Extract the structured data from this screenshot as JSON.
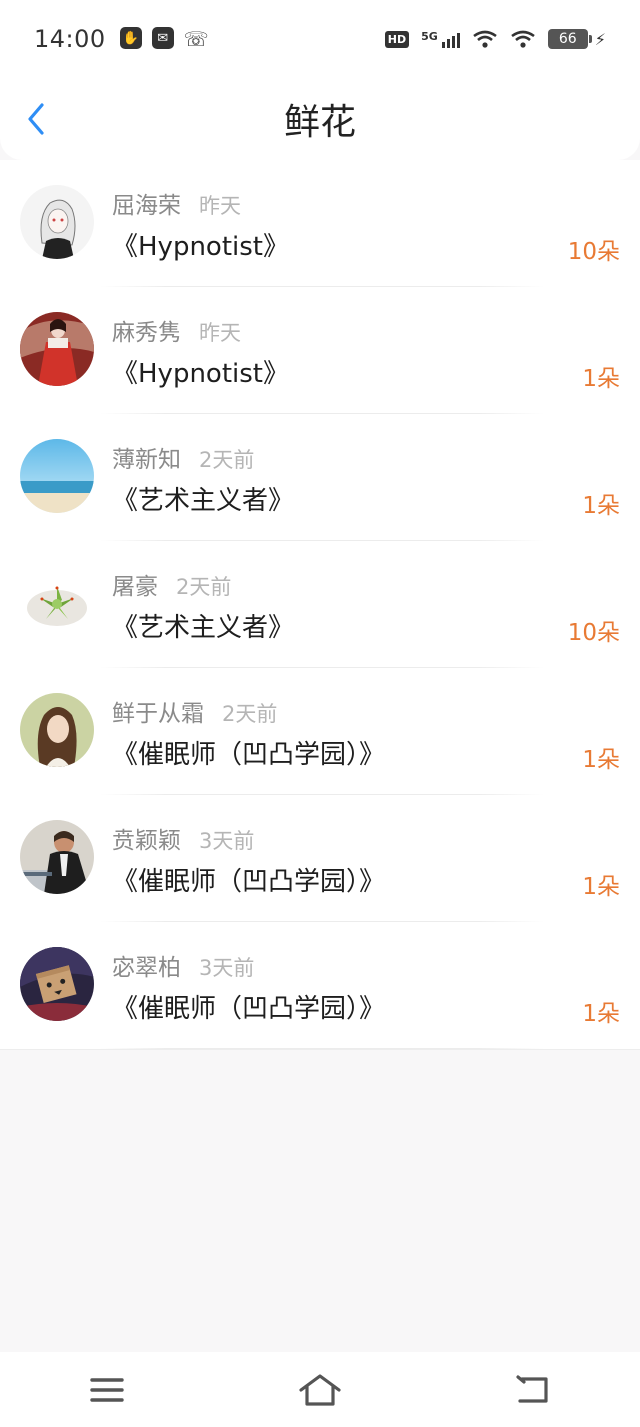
{
  "status_bar": {
    "time": "14:00",
    "left_icons": [
      "hand-icon",
      "mail-icon",
      "missed-call-icon"
    ],
    "hd_label": "HD",
    "network_label": "5G",
    "battery_level": "66"
  },
  "header": {
    "title": "鲜花",
    "back_icon": "chevron-left-icon"
  },
  "colors": {
    "accent_blue": "#2f8ef5",
    "flower_count_orange": "#e87a34",
    "name_gray": "#8a8a8a",
    "time_gray": "#b5b5b5"
  },
  "gifts": [
    {
      "name": "屈海荣",
      "time": "昨天",
      "book": "《Hypnotist》",
      "count": "10朵",
      "avatar": "sketch-girl-avatar"
    },
    {
      "name": "麻秀隽",
      "time": "昨天",
      "book": "《Hypnotist》",
      "count": "1朵",
      "avatar": "hanfu-girl-avatar"
    },
    {
      "name": "薄新知",
      "time": "2天前",
      "book": "《艺术主义者》",
      "count": "1朵",
      "avatar": "beach-sky-avatar"
    },
    {
      "name": "屠豪",
      "time": "2天前",
      "book": "《艺术主义者》",
      "count": "10朵",
      "avatar": "succulent-avatar"
    },
    {
      "name": "鲜于从霜",
      "time": "2天前",
      "book": "《催眠师（凹凸学园）》",
      "count": "1朵",
      "avatar": "woman-portrait-avatar"
    },
    {
      "name": "贲颖颖",
      "time": "3天前",
      "book": "《催眠师（凹凸学园）》",
      "count": "1朵",
      "avatar": "stressed-man-avatar"
    },
    {
      "name": "宓翠柏",
      "time": "3天前",
      "book": "《催眠师（凹凸学园）》",
      "count": "1朵",
      "avatar": "danbo-box-avatar"
    }
  ],
  "nav": {
    "icons": [
      "menu-icon",
      "home-icon",
      "back-icon"
    ]
  }
}
